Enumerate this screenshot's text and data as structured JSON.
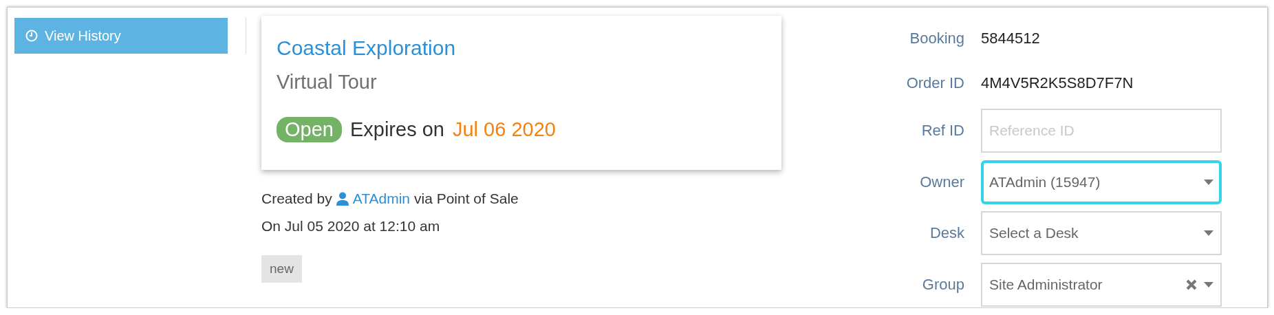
{
  "history_button": {
    "label": "View History"
  },
  "card": {
    "title": "Coastal Exploration",
    "subtitle": "Virtual Tour",
    "status": "Open",
    "expires_label": "Expires on",
    "expires_date": "Jul 06 2020"
  },
  "created": {
    "prefix": "Created by",
    "user": "ATAdmin",
    "suffix": "via Point of Sale",
    "date": "On Jul 05 2020 at 12:10 am"
  },
  "tags": [
    "new"
  ],
  "details": [
    {
      "kind": "text",
      "label": "Booking",
      "value": "5844512"
    },
    {
      "kind": "text",
      "label": "Order ID",
      "value": "4M4V5R2K5S8D7F7N"
    },
    {
      "kind": "input",
      "label": "Ref ID",
      "placeholder": "Reference ID",
      "focused": false
    },
    {
      "kind": "select",
      "label": "Owner",
      "value": "ATAdmin (15947)",
      "focused": true,
      "clearable": false
    },
    {
      "kind": "select",
      "label": "Desk",
      "value": "Select a Desk",
      "focused": false,
      "clearable": false
    },
    {
      "kind": "select",
      "label": "Group",
      "value": "Site Administrator",
      "focused": false,
      "clearable": true
    }
  ]
}
